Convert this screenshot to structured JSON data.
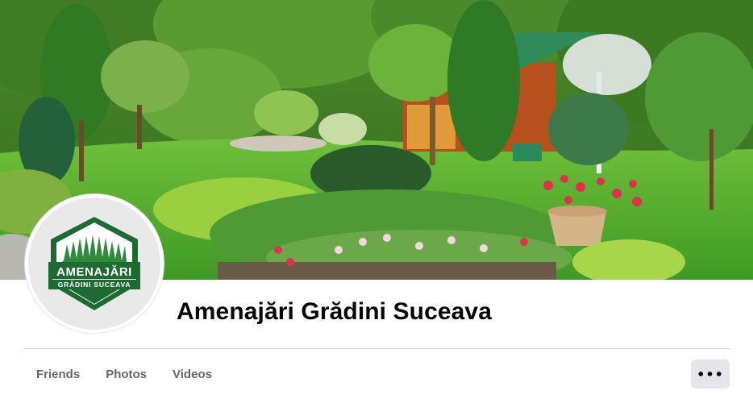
{
  "page": {
    "title": "Amenajări Grădini Suceava"
  },
  "logo": {
    "line1": "AMENAJĂRI",
    "line2": "GRĂDINI SUCEAVA"
  },
  "tabs": [
    {
      "label": "Friends"
    },
    {
      "label": "Photos"
    },
    {
      "label": "Videos"
    }
  ],
  "more_button": {
    "icon": "more-horizontal-icon",
    "glyph": "•••"
  },
  "colors": {
    "logo_green": "#1e6b32",
    "title_text": "#050505",
    "tab_text": "#65676b",
    "button_bg": "#e4e6eb"
  }
}
